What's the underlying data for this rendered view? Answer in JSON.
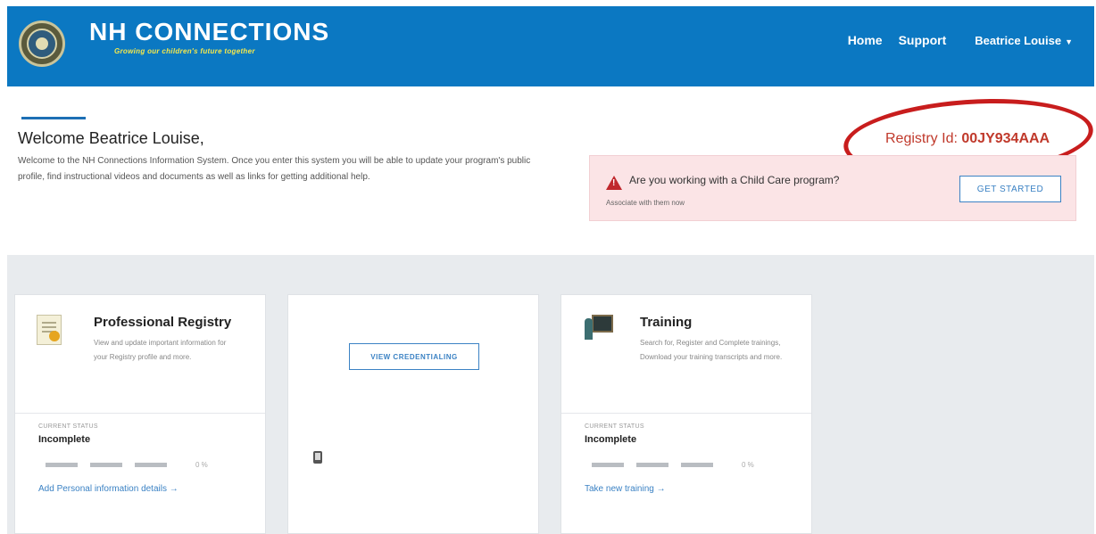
{
  "header": {
    "brand_title": "NH CONNECTIONS",
    "tagline": "Growing our children's future together",
    "nav": {
      "home": "Home",
      "support": "Support",
      "user": "Beatrice Louise"
    },
    "colors": {
      "header_bg": "#0b78c2",
      "tagline": "#f5e84c"
    }
  },
  "welcome": {
    "title": "Welcome Beatrice Louise,",
    "text": "Welcome to the NH Connections Information System. Once you enter this system you will be able to update your program's public profile, find instructional videos and documents as well as links for getting additional help."
  },
  "registry": {
    "label": "Registry Id:",
    "value": "00JY934AAA"
  },
  "alert": {
    "title": "Are you working with a Child Care program?",
    "subtitle": "Associate with them now",
    "button": "GET STARTED",
    "icon": "warning-icon"
  },
  "cards": [
    {
      "title": "Professional Registry",
      "description": "View and update important information for your Registry profile and more.",
      "status_label": "CURRENT STATUS",
      "status_value": "Incomplete",
      "progress_text": "0 %",
      "link": "Add Personal information details →"
    },
    {
      "button": "VIEW CREDENTIALING"
    },
    {
      "title": "Training",
      "description": "Search for, Register and Complete trainings, Download your training transcripts and more.",
      "status_label": "CURRENT STATUS",
      "status_value": "Incomplete",
      "progress_text": "0 %",
      "link": "Take new training →"
    }
  ]
}
